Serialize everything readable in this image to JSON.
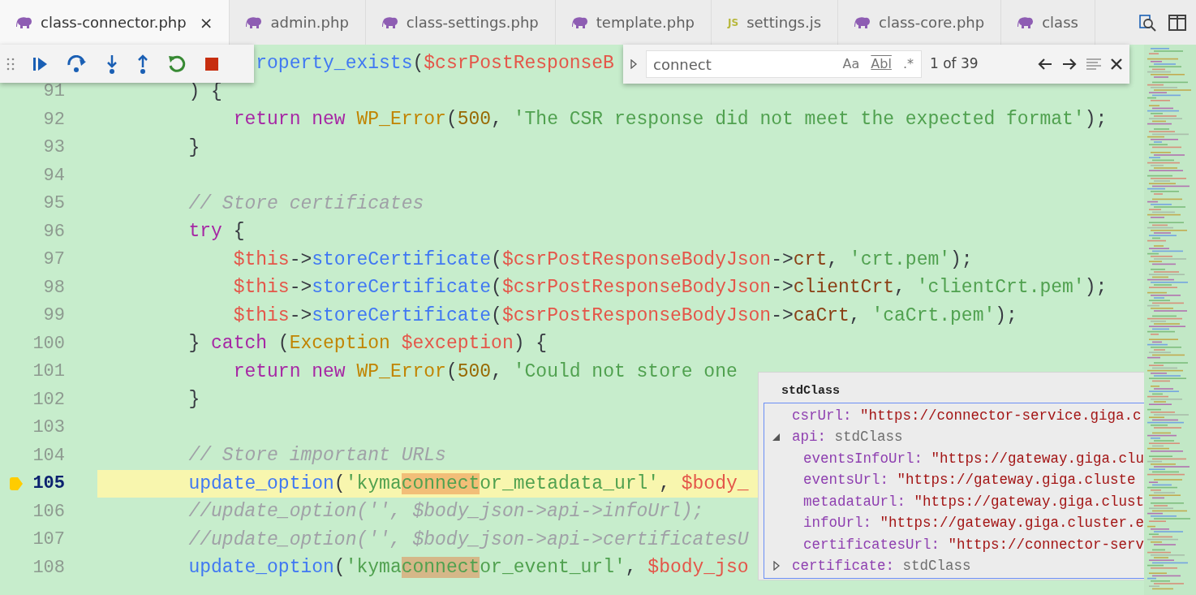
{
  "tabs": [
    {
      "label": "class-connector.php",
      "kind": "php",
      "selected": true,
      "close": "×"
    },
    {
      "label": "admin.php",
      "kind": "php",
      "selected": false
    },
    {
      "label": "class-settings.php",
      "kind": "php",
      "selected": false
    },
    {
      "label": "template.php",
      "kind": "php",
      "selected": false
    },
    {
      "label": "settings.js",
      "kind": "js",
      "icon_text": "JS",
      "selected": false
    },
    {
      "label": "class-core.php",
      "kind": "php",
      "selected": false
    },
    {
      "label": "class",
      "kind": "php",
      "selected": false
    }
  ],
  "find": {
    "value": "connect",
    "options": [
      {
        "label": "Aa",
        "on": false
      },
      {
        "label": "Abl",
        "on": false
      },
      {
        "label": ".*",
        "on": false
      }
    ],
    "count": "1 of 39"
  },
  "lines": [
    {
      "current": false,
      "tokens": [
        {
          "text": "              roperty_exists",
          "kind": "fn"
        },
        {
          "text": "(",
          "kind": "p"
        },
        {
          "text": "$csrPostResponseB",
          "kind": "var"
        }
      ]
    },
    {
      "number": "91",
      "current": false,
      "tokens": [
        {
          "text": "        ) {",
          "kind": "p"
        }
      ]
    },
    {
      "number": "92",
      "current": false,
      "tokens": [
        {
          "text": "            return new ",
          "kind": "kw"
        },
        {
          "text": "WP_Error",
          "kind": "cls"
        },
        {
          "text": "(",
          "kind": "p"
        },
        {
          "text": "500",
          "kind": "num"
        },
        {
          "text": ", ",
          "kind": "p"
        },
        {
          "text": "'The CSR response did not meet the expected format'",
          "kind": "str"
        },
        {
          "text": ");",
          "kind": "p"
        }
      ]
    },
    {
      "number": "93",
      "current": false,
      "tokens": [
        {
          "text": "        }",
          "kind": "p"
        }
      ]
    },
    {
      "number": "94",
      "current": false
    },
    {
      "number": "95",
      "current": false,
      "tokens": [
        {
          "text": "        // Store certificates",
          "kind": "cm"
        }
      ]
    },
    {
      "number": "96",
      "current": false,
      "tokens": [
        {
          "text": "        try",
          "kind": "kw"
        },
        {
          "text": " {",
          "kind": "p"
        }
      ]
    },
    {
      "number": "97",
      "current": false,
      "tokens": [
        {
          "text": "            $this",
          "kind": "var"
        },
        {
          "text": "->",
          "kind": "p"
        },
        {
          "text": "storeCertificate",
          "kind": "fn"
        },
        {
          "text": "(",
          "kind": "p"
        },
        {
          "text": "$csrPostResponseBodyJson",
          "kind": "var"
        },
        {
          "text": "->",
          "kind": "p"
        },
        {
          "text": "crt",
          "kind": "prop"
        },
        {
          "text": ", ",
          "kind": "p"
        },
        {
          "text": "'crt.pem'",
          "kind": "str"
        },
        {
          "text": ");",
          "kind": "p"
        }
      ]
    },
    {
      "number": "98",
      "current": false,
      "tokens": [
        {
          "text": "            $this",
          "kind": "var"
        },
        {
          "text": "->",
          "kind": "p"
        },
        {
          "text": "storeCertificate",
          "kind": "fn"
        },
        {
          "text": "(",
          "kind": "p"
        },
        {
          "text": "$csrPostResponseBodyJson",
          "kind": "var"
        },
        {
          "text": "->",
          "kind": "p"
        },
        {
          "text": "clientCrt",
          "kind": "prop"
        },
        {
          "text": ", ",
          "kind": "p"
        },
        {
          "text": "'clientCrt.pem'",
          "kind": "str"
        },
        {
          "text": ");",
          "kind": "p"
        }
      ]
    },
    {
      "number": "99",
      "current": false,
      "tokens": [
        {
          "text": "            $this",
          "kind": "var"
        },
        {
          "text": "->",
          "kind": "p"
        },
        {
          "text": "storeCertificate",
          "kind": "fn"
        },
        {
          "text": "(",
          "kind": "p"
        },
        {
          "text": "$csrPostResponseBodyJson",
          "kind": "var"
        },
        {
          "text": "->",
          "kind": "p"
        },
        {
          "text": "caCrt",
          "kind": "prop"
        },
        {
          "text": ", ",
          "kind": "p"
        },
        {
          "text": "'caCrt.pem'",
          "kind": "str"
        },
        {
          "text": ");",
          "kind": "p"
        }
      ]
    },
    {
      "number": "100",
      "current": false,
      "tokens": [
        {
          "text": "        } ",
          "kind": "p"
        },
        {
          "text": "catch",
          "kind": "kw"
        },
        {
          "text": " (",
          "kind": "p"
        },
        {
          "text": "Exception",
          "kind": "cls"
        },
        {
          "text": " $exception",
          "kind": "var"
        },
        {
          "text": ") {",
          "kind": "p"
        }
      ]
    },
    {
      "number": "101",
      "current": false,
      "tokens": [
        {
          "text": "            return new ",
          "kind": "kw"
        },
        {
          "text": "WP_Error",
          "kind": "cls"
        },
        {
          "text": "(",
          "kind": "p"
        },
        {
          "text": "500",
          "kind": "num"
        },
        {
          "text": ", ",
          "kind": "p"
        },
        {
          "text": "'Could not store one",
          "kind": "str"
        }
      ]
    },
    {
      "number": "102",
      "current": false,
      "tokens": [
        {
          "text": "        }",
          "kind": "p"
        }
      ]
    },
    {
      "number": "103",
      "current": false
    },
    {
      "number": "104",
      "current": false,
      "tokens": [
        {
          "text": "        // Store important URLs",
          "kind": "cm"
        }
      ]
    },
    {
      "number": "105",
      "current": true,
      "tokens": [
        {
          "text": "        update_option",
          "kind": "fn"
        },
        {
          "text": "(",
          "kind": "p"
        },
        {
          "text": "'kyma",
          "kind": "str"
        },
        {
          "text": "connect",
          "kind": "str",
          "selected": true
        },
        {
          "text": "or_metadata_url'",
          "kind": "str"
        },
        {
          "text": ", ",
          "kind": "p"
        },
        {
          "text": "$body_",
          "kind": "var"
        }
      ]
    },
    {
      "number": "106",
      "current": false,
      "tokens": [
        {
          "text": "        //update_option('', $body_json->api->infoUrl);",
          "kind": "cm"
        }
      ]
    },
    {
      "number": "107",
      "current": false,
      "tokens": [
        {
          "text": "        //update_option('', $body_json->api->certificatesU",
          "kind": "cm"
        }
      ]
    },
    {
      "number": "108",
      "current": false,
      "tokens": [
        {
          "text": "        update_option",
          "kind": "fn"
        },
        {
          "text": "(",
          "kind": "p"
        },
        {
          "text": "'kyma",
          "kind": "str"
        },
        {
          "text": "connect",
          "kind": "str",
          "selected": false
        },
        {
          "text": "or_event_url'",
          "kind": "str"
        },
        {
          "text": ", ",
          "kind": "p"
        },
        {
          "text": "$body_jso",
          "kind": "var"
        }
      ]
    }
  ],
  "hover": {
    "title": "stdClass",
    "items": [
      {
        "key": "csrUrl:",
        "value": "\"https://connector-service.giga.c",
        "kind": "string"
      },
      {
        "key": "api:",
        "value": "stdClass",
        "kind": "object",
        "expanded": true,
        "children": [
          {
            "key": "eventsInfoUrl:",
            "value": "\"https://gateway.giga.clu",
            "kind": "string"
          },
          {
            "key": "eventsUrl:",
            "value": "\"https://gateway.giga.cluste",
            "kind": "string"
          },
          {
            "key": "metadataUrl:",
            "value": "\"https://gateway.giga.clust",
            "kind": "string"
          },
          {
            "key": "infoUrl:",
            "value": "\"https://gateway.giga.cluster.e",
            "kind": "string"
          },
          {
            "key": "certificatesUrl:",
            "value": "\"https://connector-serv",
            "kind": "string"
          }
        ]
      },
      {
        "key": "certificate:",
        "value": "stdClass",
        "kind": "object",
        "expanded": false
      }
    ]
  }
}
